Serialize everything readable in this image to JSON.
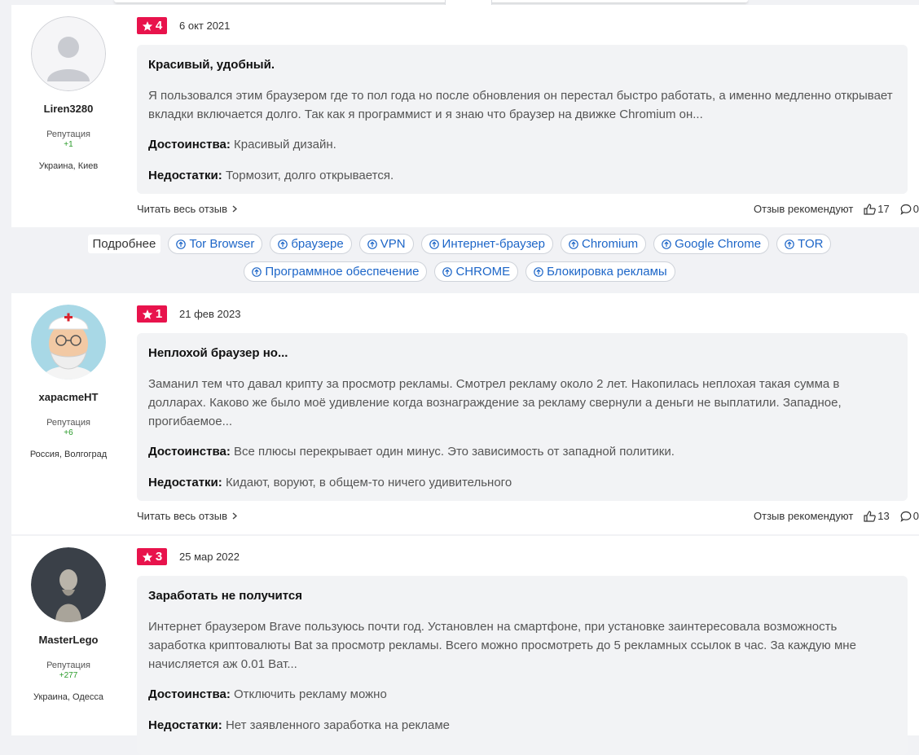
{
  "tags": {
    "more_label": "Подробнее",
    "row1": [
      "Tor Browser",
      "браузере",
      "VPN",
      "Интернет-браузер",
      "Chromium",
      "Google Chrome",
      "TOR"
    ],
    "row2": [
      "Программное обеспечение",
      "CHROME",
      "Блокировка рекламы"
    ]
  },
  "colors": {
    "rating_badge": "#e8134c",
    "tag_link": "#1d66c8",
    "reputation": "#2a9b2a"
  },
  "reviews": [
    {
      "username": "Liren3280",
      "reputation_label": "Репутация",
      "reputation": "+1",
      "location": "Украина, Киев",
      "rating": "4",
      "date": "6 окт 2021",
      "title": "Красивый, удобный.",
      "text": "Я пользовался этим браузером где то пол года но после обновления он перестал быстро работать, а именно медленно открывает вкладки включается долго. Так как я программист и я знаю что браузер на движке Chromium он...",
      "pros_label": "Достоинства:",
      "pros": "Красивый дизайн.",
      "cons_label": "Недостатки:",
      "cons": "Тормозит, долго открывается.",
      "read_more": "Читать весь отзыв",
      "recommend_label": "Отзыв рекомендуют",
      "likes": "17",
      "comments": "0"
    },
    {
      "username": "харасmeНТ",
      "reputation_label": "Репутация",
      "reputation": "+6",
      "location": "Россия, Волгоград",
      "rating": "1",
      "date": "21 фев 2023",
      "title": "Неплохой браузер но...",
      "text": "Заманил тем что давал крипту за просмотр рекламы. Смотрел рекламу около 2 лет. Накопилась неплохая такая сумма в долларах. Каково же было моё удивление когда вознаграждение за рекламу свернули а деньги не выплатили. Западное, прогибаемое...",
      "pros_label": "Достоинства:",
      "pros": "Все плюсы перекрывает один минус. Это зависимость от западной политики.",
      "cons_label": "Недостатки:",
      "cons": "Кидают, воруют, в общем-то ничего удивительного",
      "read_more": "Читать весь отзыв",
      "recommend_label": "Отзыв рекомендуют",
      "likes": "13",
      "comments": "0"
    },
    {
      "username": "MasterLego",
      "reputation_label": "Репутация",
      "reputation": "+277",
      "location": "Украина, Одесса",
      "rating": "3",
      "date": "25 мар 2022",
      "title": "Заработать не получится",
      "text": "Интернет браузером Brave пользуюсь почти год. Установлен на смартфоне, при установке заинтересовала возможность заработка криптовалюты Bat за просмотр рекламы. Всего можно просмотреть до 5 рекламных ссылок в час. За каждую мне начисляется аж 0.01 Ват...",
      "pros_label": "Достоинства:",
      "pros": "Отключить рекламу можно",
      "cons_label": "Недостатки:",
      "cons": "Нет заявленного заработка на рекламе"
    }
  ]
}
